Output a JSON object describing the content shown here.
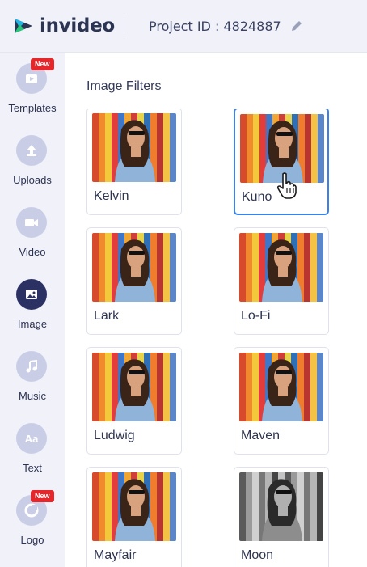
{
  "header": {
    "brand": "invideo",
    "project_id": "Project ID : 4824887"
  },
  "rail": {
    "items": [
      {
        "label": "Templates",
        "icon": "templates-icon",
        "badge": "New",
        "active": false
      },
      {
        "label": "Uploads",
        "icon": "upload-icon",
        "badge": "",
        "active": false
      },
      {
        "label": "Video",
        "icon": "video-camera-icon",
        "badge": "",
        "active": false
      },
      {
        "label": "Image",
        "icon": "image-icon",
        "badge": "",
        "active": true
      },
      {
        "label": "Music",
        "icon": "music-note-icon",
        "badge": "",
        "active": false
      },
      {
        "label": "Text",
        "icon": "text-icon",
        "badge": "",
        "active": false
      },
      {
        "label": "Logo",
        "icon": "logo-icon",
        "badge": "New",
        "active": false
      }
    ],
    "text_icon_glyph": "Aa"
  },
  "panel": {
    "title": "Image Filters",
    "filters": [
      {
        "name": "Kelvin",
        "tone": "color",
        "selected": false
      },
      {
        "name": "Kuno",
        "tone": "color",
        "selected": true
      },
      {
        "name": "Lark",
        "tone": "color",
        "selected": false
      },
      {
        "name": "Lo-Fi",
        "tone": "color",
        "selected": false
      },
      {
        "name": "Ludwig",
        "tone": "color",
        "selected": false
      },
      {
        "name": "Maven",
        "tone": "color",
        "selected": false
      },
      {
        "name": "Mayfair",
        "tone": "color",
        "selected": false
      },
      {
        "name": "Moon",
        "tone": "grayscale",
        "selected": false
      }
    ]
  },
  "colors": {
    "accent": "#3b82e8",
    "badge": "#e5262b",
    "rail_active": "#2b3163",
    "rail_circle": "#c9cde6"
  }
}
